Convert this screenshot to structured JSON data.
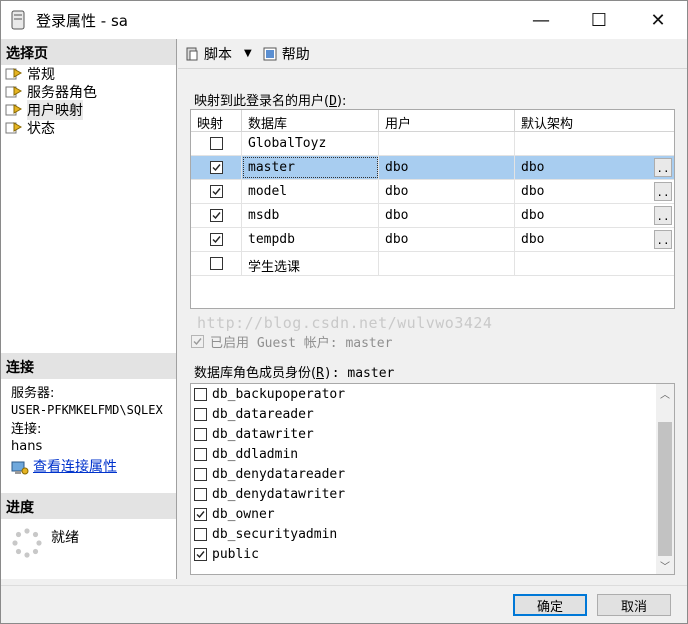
{
  "window": {
    "title": "登录属性 - sa",
    "minimize": "—",
    "maximize": "☐",
    "close": "✕"
  },
  "left_panel": {
    "select_page_heading": "选择页",
    "pages": [
      {
        "label": "常规",
        "icon": "page-icon"
      },
      {
        "label": "服务器角色",
        "icon": "page-icon"
      },
      {
        "label": "用户映射",
        "icon": "page-icon",
        "selected": true
      },
      {
        "label": "状态",
        "icon": "page-icon"
      }
    ],
    "connection_heading": "连接",
    "server_label": "服务器:",
    "server_value": "USER-PFKMKELFMD\\SQLEX",
    "connection_label": "连接:",
    "connection_value": "hans",
    "view_conn_props": "查看连接属性",
    "progress_heading": "进度",
    "progress_status": "就绪"
  },
  "toolbar": {
    "script_label": "脚本",
    "help_label": "帮助"
  },
  "mapping": {
    "label_prefix": "映射到此登录名的用户(",
    "label_key": "D",
    "label_suffix": "):",
    "columns": [
      "映射",
      "数据库",
      "用户",
      "默认架构"
    ],
    "rows": [
      {
        "mapped": false,
        "database": "GlobalToyz",
        "user": "",
        "schema": ""
      },
      {
        "mapped": true,
        "database": "master",
        "user": "dbo",
        "schema": "dbo",
        "selected": true
      },
      {
        "mapped": true,
        "database": "model",
        "user": "dbo",
        "schema": "dbo"
      },
      {
        "mapped": true,
        "database": "msdb",
        "user": "dbo",
        "schema": "dbo"
      },
      {
        "mapped": true,
        "database": "tempdb",
        "user": "dbo",
        "schema": "dbo"
      },
      {
        "mapped": false,
        "database": "学生选课",
        "user": "",
        "schema": ""
      }
    ],
    "ellipsis": ".."
  },
  "watermark": "http://blog.csdn.net/wulvwo3424",
  "guest": {
    "checked": true,
    "disabled": true,
    "label": "已启用 Guest 帐户: master"
  },
  "roles": {
    "label_prefix": "数据库角色成员身份(",
    "label_key": "R",
    "label_suffix": "): master",
    "items": [
      {
        "name": "db_backupoperator",
        "checked": false
      },
      {
        "name": "db_datareader",
        "checked": false
      },
      {
        "name": "db_datawriter",
        "checked": false
      },
      {
        "name": "db_ddladmin",
        "checked": false
      },
      {
        "name": "db_denydatareader",
        "checked": false
      },
      {
        "name": "db_denydatawriter",
        "checked": false
      },
      {
        "name": "db_owner",
        "checked": true
      },
      {
        "name": "db_securityadmin",
        "checked": false
      },
      {
        "name": "public",
        "checked": true
      }
    ]
  },
  "footer": {
    "ok_label": "确定",
    "cancel_label": "取消"
  }
}
